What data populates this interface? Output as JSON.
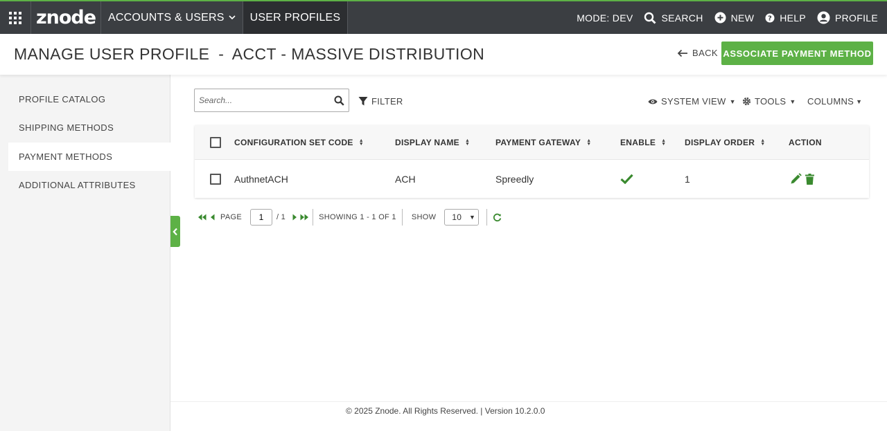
{
  "topnav": {
    "logo": "znode",
    "accounts_menu": "ACCOUNTS & USERS",
    "user_profiles": "USER PROFILES",
    "mode": "MODE: DEV",
    "search": "SEARCH",
    "new": "NEW",
    "help": "HELP",
    "profile": "PROFILE"
  },
  "header": {
    "title": "MANAGE USER PROFILE",
    "separator": "-",
    "account": "ACCT - MASSIVE DISTRIBUTION",
    "back": "BACK",
    "primary_button": "ASSOCIATE PAYMENT METHOD"
  },
  "sidebar": {
    "items": [
      {
        "label": "PROFILE CATALOG",
        "active": false
      },
      {
        "label": "SHIPPING METHODS",
        "active": false
      },
      {
        "label": "PAYMENT METHODS",
        "active": true
      },
      {
        "label": "ADDITIONAL ATTRIBUTES",
        "active": false
      }
    ]
  },
  "toolbar": {
    "search_placeholder": "Search...",
    "filter": "FILTER",
    "system_view": "SYSTEM VIEW",
    "tools": "TOOLS",
    "columns": "COLUMNS"
  },
  "grid": {
    "columns": [
      "CONFIGURATION SET CODE",
      "DISPLAY NAME",
      "PAYMENT GATEWAY",
      "ENABLE",
      "DISPLAY ORDER",
      "ACTION"
    ],
    "rows": [
      {
        "code": "AuthnetACH",
        "display_name": "ACH",
        "gateway": "Spreedly",
        "enabled": true,
        "display_order": "1"
      }
    ]
  },
  "pager": {
    "page_label": "PAGE",
    "page_value": "1",
    "total_pages": "/ 1",
    "showing": "SHOWING 1 - 1 OF 1",
    "show_label": "SHOW",
    "page_size": "10"
  },
  "footer": {
    "text": "© 2025 Znode. All Rights Reserved. | Version 10.2.0.0"
  },
  "colors": {
    "brand_green": "#5db146",
    "topbar": "#3b3e42",
    "action_green": "#3a8a2f"
  }
}
